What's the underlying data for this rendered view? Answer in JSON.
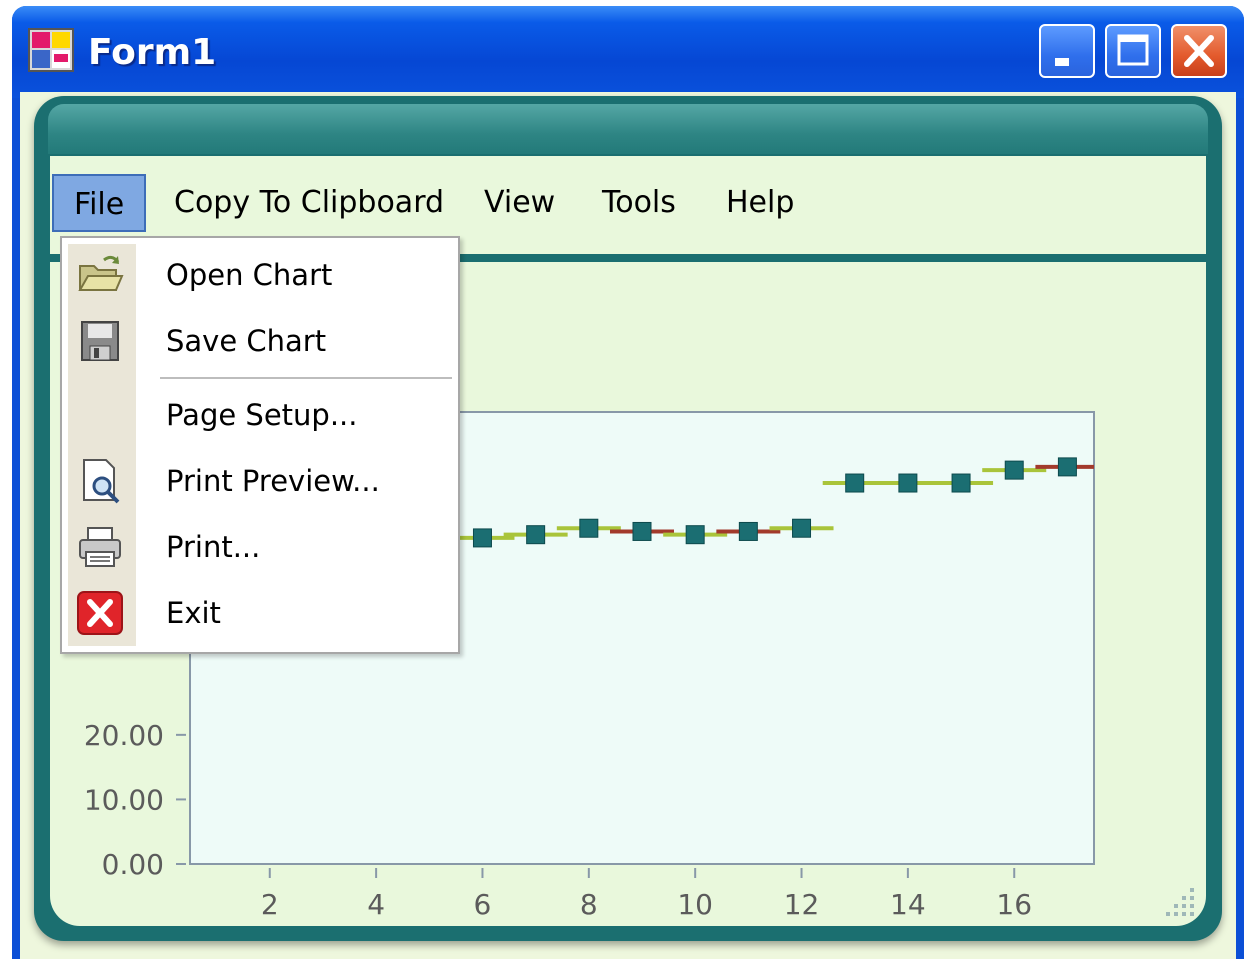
{
  "window": {
    "title": "Form1"
  },
  "menubar": {
    "items": [
      {
        "label": "File"
      },
      {
        "label": "Copy To Clipboard"
      },
      {
        "label": "View"
      },
      {
        "label": "Tools"
      },
      {
        "label": "Help"
      }
    ]
  },
  "file_menu": {
    "items": [
      {
        "label": "Open Chart",
        "icon": "open-folder-icon"
      },
      {
        "label": "Save Chart",
        "icon": "floppy-disk-icon"
      },
      {
        "label": "Page Setup...",
        "icon": ""
      },
      {
        "label": "Print Preview...",
        "icon": "print-preview-icon"
      },
      {
        "label": "Print...",
        "icon": "printer-icon"
      },
      {
        "label": "Exit",
        "icon": "exit-icon"
      }
    ]
  },
  "colors": {
    "titlebar": "#0a5be8",
    "skin": "#1b6f70",
    "client_bg": "#e9f8dc",
    "plot_bg": "#eefbf8",
    "marker": "#1b6e72",
    "line_up": "#a9c43a",
    "line_down": "#a23a2c"
  },
  "chart_data": {
    "type": "scatter",
    "x_ticks": [
      "2",
      "4",
      "6",
      "8",
      "10",
      "12",
      "14",
      "16"
    ],
    "y_ticks": [
      "0.00",
      "10.00",
      "20.00"
    ],
    "xlim": [
      0.5,
      17.5
    ],
    "ylim": [
      0,
      70
    ],
    "series": [
      {
        "x": [
          6,
          7,
          8,
          9,
          10,
          11,
          12,
          13,
          14,
          15,
          16,
          17
        ],
        "values": [
          50.5,
          51.0,
          52.0,
          51.5,
          51.0,
          51.5,
          52.0,
          59.0,
          59.0,
          59.0,
          61.0,
          61.5
        ],
        "trend": [
          "up",
          "up",
          "up",
          "down",
          "up",
          "down",
          "up",
          "up",
          "up",
          "up",
          "up",
          "down"
        ]
      }
    ]
  }
}
